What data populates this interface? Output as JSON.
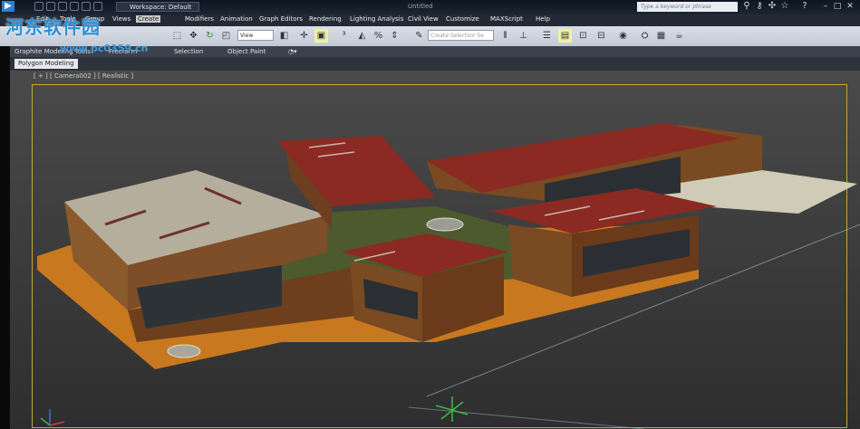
{
  "window": {
    "title": "Untitled",
    "workspace": "Workspace: Default"
  },
  "search": {
    "placeholder": "Type a keyword or phrase"
  },
  "menu": [
    "Edit",
    "Tools",
    "Group",
    "Views",
    "Create",
    "Modifiers",
    "Animation",
    "Graph Editors",
    "Rendering",
    "Lighting Analysis",
    "Civil View",
    "Customize",
    "MAXScript",
    "Help"
  ],
  "toolbar": {
    "view_dropdown": "View",
    "selection_set": "Create Selection Se"
  },
  "ribbon": {
    "tabs": [
      "Graphite Modeling Tools",
      "Freeform",
      "Selection",
      "Object Paint"
    ],
    "panel": "Polygon Modeling"
  },
  "viewport": {
    "label": "[ + ] [ Camera002 ] [ Realistic ]"
  },
  "watermark": {
    "main": "河东软件园",
    "url": "www.pc0359.cn"
  }
}
